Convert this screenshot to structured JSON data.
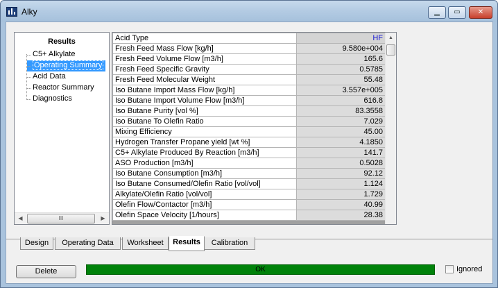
{
  "window": {
    "title": "Alky",
    "controls": {
      "minimize": "▁",
      "maximize": "▭",
      "close": "✕"
    }
  },
  "tree": {
    "title": "Results",
    "items": [
      {
        "label": "C5+ Alkylate",
        "selected": false
      },
      {
        "label": "Operating Summary",
        "selected": true
      },
      {
        "label": "Acid Data",
        "selected": false
      },
      {
        "label": "Reactor Summary",
        "selected": false
      },
      {
        "label": "Diagnostics",
        "selected": false
      }
    ],
    "scroll_left": "◀",
    "scroll_right": "▶",
    "scroll_grip": "III"
  },
  "grid": {
    "header": {
      "label": "Acid Type",
      "value": "HF"
    },
    "rows": [
      {
        "label": "Fresh Feed Mass Flow [kg/h]",
        "value": "9.580e+004"
      },
      {
        "label": "Fresh Feed Volume Flow [m3/h]",
        "value": "165.6"
      },
      {
        "label": "Fresh Feed Specific Gravity",
        "value": "0.5785"
      },
      {
        "label": "Fresh Feed Molecular Weight",
        "value": "55.48"
      },
      {
        "label": "Iso Butane Import Mass Flow [kg/h]",
        "value": "3.557e+005"
      },
      {
        "label": "Iso Butane Import Volume Flow [m3/h]",
        "value": "616.8"
      },
      {
        "label": "Iso Butane Purity [vol %]",
        "value": "83.3558"
      },
      {
        "label": "Iso Butane To Olefin Ratio",
        "value": "7.029"
      },
      {
        "label": "Mixing Efficiency",
        "value": "45.00"
      },
      {
        "label": "Hydrogen Transfer Propane yield [wt %]",
        "value": "4.1850"
      },
      {
        "label": "C5+ Alkylate Produced By Reaction [m3/h]",
        "value": "141.7"
      },
      {
        "label": "ASO Production [m3/h]",
        "value": "0.5028"
      },
      {
        "label": "Iso Butane Consumption [m3/h]",
        "value": "92.12"
      },
      {
        "label": "Iso Butane Consumed/Olefin Ratio [vol/vol]",
        "value": "1.124"
      },
      {
        "label": "Alkylate/Olefin Ratio [vol/vol]",
        "value": "1.729"
      },
      {
        "label": "Olefin Flow/Contactor [m3/h]",
        "value": "40.99"
      },
      {
        "label": "Olefin Space Velocity [1/hours]",
        "value": "28.38"
      }
    ],
    "scroll_up": "▲",
    "scroll_down": "▼"
  },
  "tabs": [
    {
      "label": "Design",
      "active": false
    },
    {
      "label": "Operating Data",
      "active": false
    },
    {
      "label": "Worksheet",
      "active": false
    },
    {
      "label": "Results",
      "active": true
    },
    {
      "label": "Calibration",
      "active": false
    }
  ],
  "bottom": {
    "delete_label": "Delete",
    "status_text": "OK",
    "status_color": "#00820a",
    "ignored_label": "Ignored",
    "ignored_checked": false
  }
}
